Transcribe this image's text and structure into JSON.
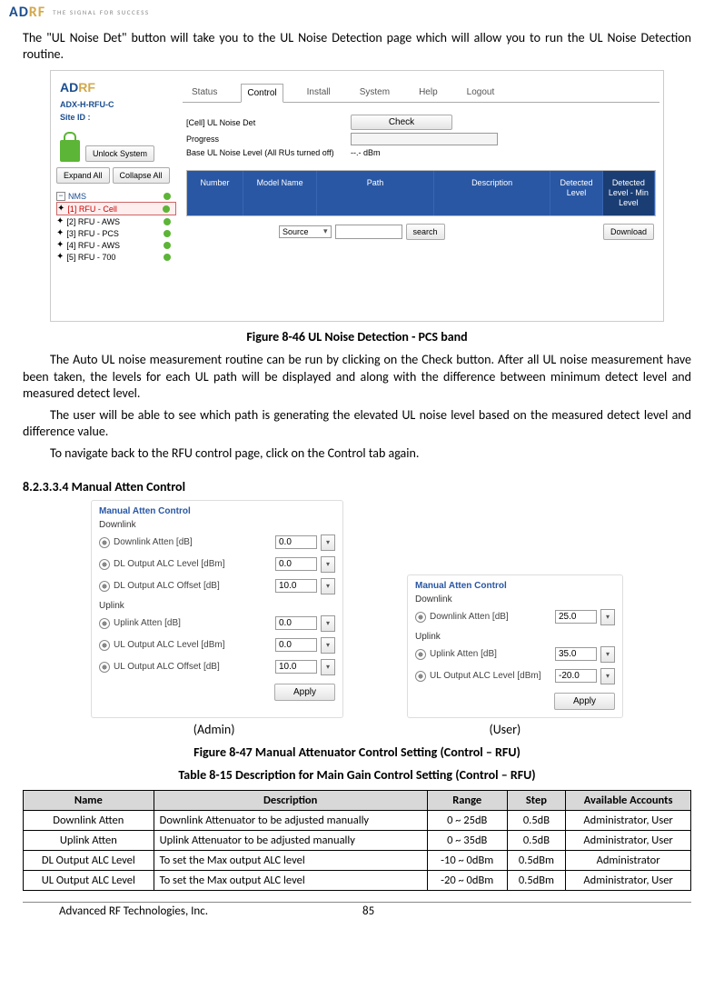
{
  "header": {
    "logo_ad": "AD",
    "logo_rf": "RF",
    "tagline": "THE SIGNAL FOR SUCCESS"
  },
  "intro": "The \"UL Noise Det\" button will take you to the UL Noise Detection page which will allow you to run the UL Noise Detection routine.",
  "screenshot1": {
    "logo_ad": "AD",
    "logo_rf": "RF",
    "sidebar": {
      "device": "ADX-H-RFU-C",
      "site": "Site ID :",
      "unlock": "Unlock System",
      "expand": "Expand All",
      "collapse": "Collapse All",
      "tree": [
        {
          "label": "NMS",
          "first": true
        },
        {
          "label": "[1] RFU - Cell",
          "red": true
        },
        {
          "label": "[2] RFU - AWS"
        },
        {
          "label": "[3] RFU - PCS"
        },
        {
          "label": "[4] RFU - AWS"
        },
        {
          "label": "[5] RFU - 700"
        }
      ]
    },
    "tabs": [
      "Status",
      "Control",
      "Install",
      "System",
      "Help",
      "Logout"
    ],
    "active_tab": "Control",
    "form": {
      "row1": "[Cell] UL Noise Det",
      "check": "Check",
      "row2": "Progress",
      "row3": "Base UL Noise Level (All RUs turned off)",
      "row3_val": "--.- dBm"
    },
    "table_headers": [
      "Number",
      "Model Name",
      "Path",
      "Description",
      "Detected Level",
      "Detected Level - Min Level"
    ],
    "search_source": "Source",
    "search_btn": "search",
    "download": "Download"
  },
  "fig1_caption": "Figure 8-46    UL Noise Detection - PCS band",
  "para2": "The Auto UL noise measurement routine can be run by clicking on the Check button.  After all UL noise measurement have been taken, the levels for each UL path will be displayed and along with the difference between minimum detect level and measured detect level.",
  "para3": "The user will be able to see which path is generating the elevated UL noise level based on the measured detect level and difference value.",
  "para4": "To navigate back to the RFU control page, click on the Control tab again.",
  "section_heading": "8.2.3.3.4    Manual Atten Control",
  "atten_admin": {
    "title": "Manual Atten Control",
    "dl": "Downlink",
    "rows_dl": [
      {
        "label": "Downlink Atten [dB]",
        "value": "0.0"
      },
      {
        "label": "DL Output ALC Level [dBm]",
        "value": "0.0"
      },
      {
        "label": "DL Output ALC Offset [dB]",
        "value": "10.0"
      }
    ],
    "ul": "Uplink",
    "rows_ul": [
      {
        "label": "Uplink Atten [dB]",
        "value": "0.0"
      },
      {
        "label": "UL Output ALC Level [dBm]",
        "value": "0.0"
      },
      {
        "label": "UL Output ALC Offset [dB]",
        "value": "10.0"
      }
    ],
    "apply": "Apply"
  },
  "atten_user": {
    "title": "Manual Atten Control",
    "dl": "Downlink",
    "rows_dl": [
      {
        "label": "Downlink Atten [dB]",
        "value": "25.0"
      }
    ],
    "ul": "Uplink",
    "rows_ul": [
      {
        "label": "Uplink Atten [dB]",
        "value": "35.0"
      },
      {
        "label": "UL Output ALC Level [dBm]",
        "value": "-20.0"
      }
    ],
    "apply": "Apply"
  },
  "role_admin": "(Admin)",
  "role_user": "(User)",
  "fig2_caption": "Figure 8-47    Manual Attenuator Control Setting (Control – RFU)",
  "table_caption": "Table 8-15     Description for Main Gain Control Setting (Control – RFU)",
  "data_table": {
    "headers": [
      "Name",
      "Description",
      "Range",
      "Step",
      "Available Accounts"
    ],
    "rows": [
      [
        "Downlink Atten",
        "Downlink Attenuator to be adjusted manually",
        "0 ~ 25dB",
        "0.5dB",
        "Administrator, User"
      ],
      [
        "Uplink Atten",
        "Uplink Attenuator to be adjusted manually",
        "0 ~ 35dB",
        "0.5dB",
        "Administrator, User"
      ],
      [
        "DL Output ALC Level",
        "To set the Max output ALC level",
        "-10 ~ 0dBm",
        "0.5dBm",
        "Administrator"
      ],
      [
        "UL Output ALC Level",
        "To set the Max output ALC level",
        "-20 ~ 0dBm",
        "0.5dBm",
        "Administrator, User"
      ]
    ]
  },
  "footer": {
    "company": "Advanced RF Technologies, Inc.",
    "page": "85"
  }
}
